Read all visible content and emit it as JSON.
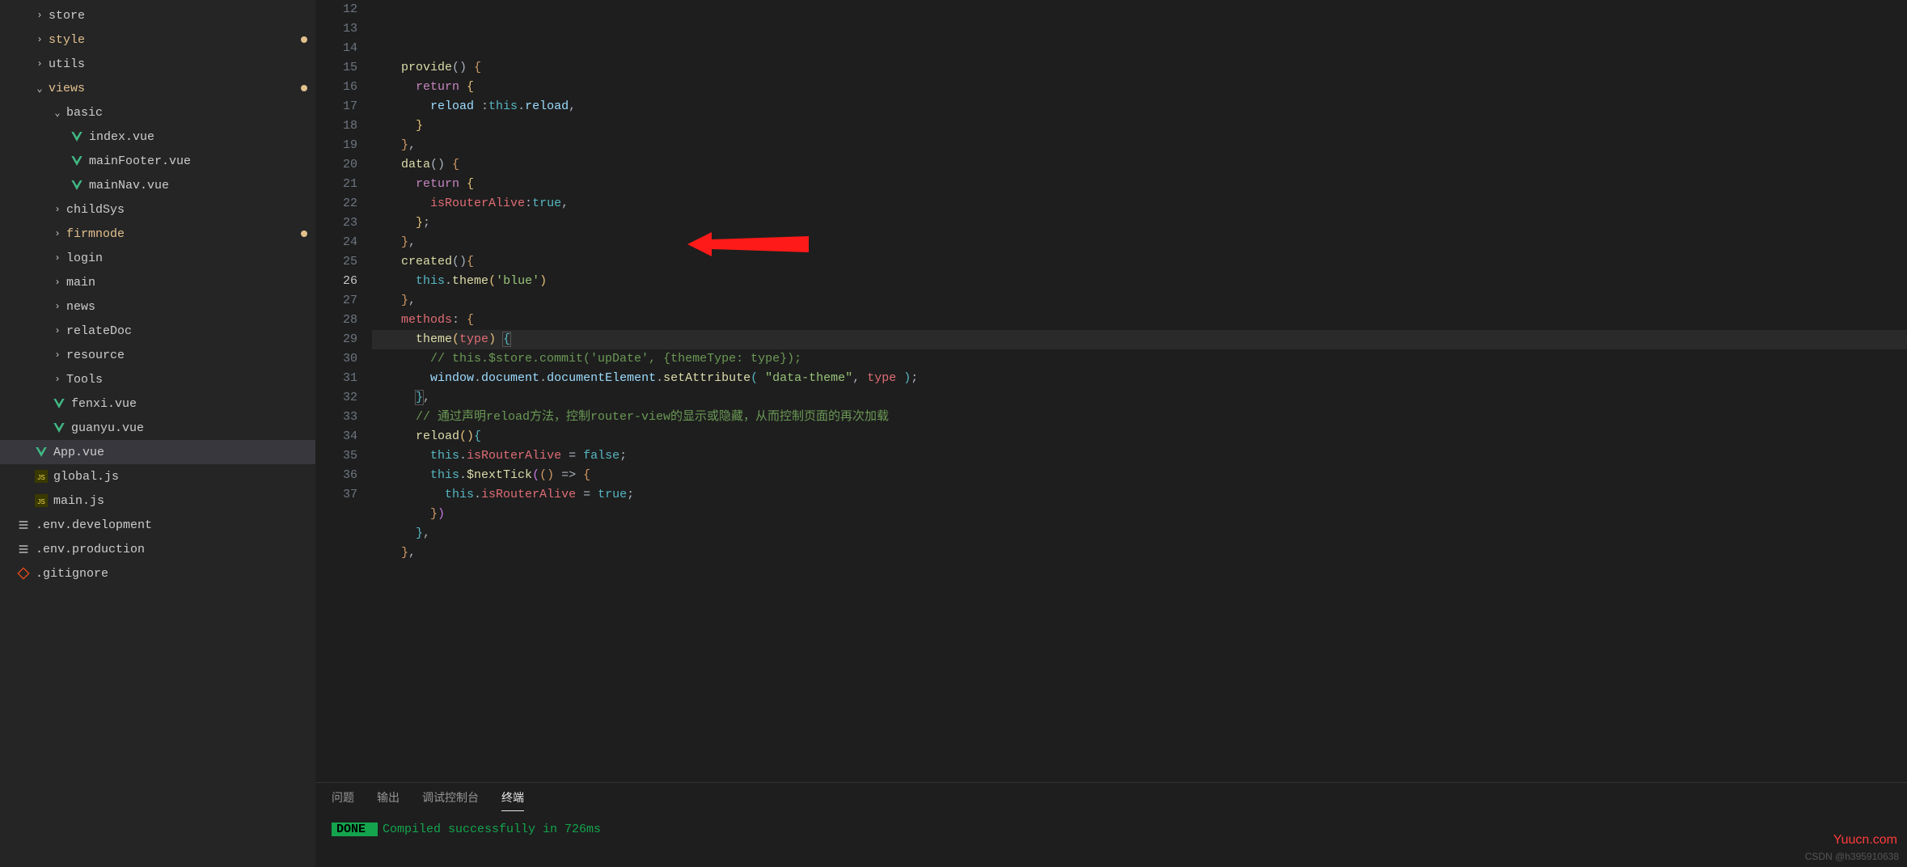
{
  "sidebar": {
    "items": [
      {
        "type": "folder",
        "depth": 1,
        "open": false,
        "label": "store",
        "hl": false,
        "icon": "chev"
      },
      {
        "type": "folder",
        "depth": 1,
        "open": false,
        "label": "style",
        "hl": true,
        "icon": "chev",
        "dot": true
      },
      {
        "type": "folder",
        "depth": 1,
        "open": false,
        "label": "utils",
        "hl": false,
        "icon": "chev"
      },
      {
        "type": "folder",
        "depth": 1,
        "open": true,
        "label": "views",
        "hl": true,
        "icon": "chev",
        "dot": true
      },
      {
        "type": "folder",
        "depth": 2,
        "open": true,
        "label": "basic",
        "hl": false,
        "icon": "chev"
      },
      {
        "type": "file",
        "depth": 3,
        "label": "index.vue",
        "hl": false,
        "icon": "vue"
      },
      {
        "type": "file",
        "depth": 3,
        "label": "mainFooter.vue",
        "hl": false,
        "icon": "vue"
      },
      {
        "type": "file",
        "depth": 3,
        "label": "mainNav.vue",
        "hl": false,
        "icon": "vue"
      },
      {
        "type": "folder",
        "depth": 2,
        "open": false,
        "label": "childSys",
        "hl": false,
        "icon": "chev"
      },
      {
        "type": "folder",
        "depth": 2,
        "open": false,
        "label": "firmnode",
        "hl": true,
        "icon": "chev",
        "dot": true
      },
      {
        "type": "folder",
        "depth": 2,
        "open": false,
        "label": "login",
        "hl": false,
        "icon": "chev"
      },
      {
        "type": "folder",
        "depth": 2,
        "open": false,
        "label": "main",
        "hl": false,
        "icon": "chev"
      },
      {
        "type": "folder",
        "depth": 2,
        "open": false,
        "label": "news",
        "hl": false,
        "icon": "chev"
      },
      {
        "type": "folder",
        "depth": 2,
        "open": false,
        "label": "relateDoc",
        "hl": false,
        "icon": "chev"
      },
      {
        "type": "folder",
        "depth": 2,
        "open": false,
        "label": "resource",
        "hl": false,
        "icon": "chev"
      },
      {
        "type": "folder",
        "depth": 2,
        "open": false,
        "label": "Tools",
        "hl": false,
        "icon": "chev"
      },
      {
        "type": "file",
        "depth": 2,
        "label": "fenxi.vue",
        "hl": false,
        "icon": "vue"
      },
      {
        "type": "file",
        "depth": 2,
        "label": "guanyu.vue",
        "hl": false,
        "icon": "vue"
      },
      {
        "type": "file",
        "depth": 1,
        "label": "App.vue",
        "hl": false,
        "icon": "vue",
        "active": true
      },
      {
        "type": "file",
        "depth": 1,
        "label": "global.js",
        "hl": false,
        "icon": "js"
      },
      {
        "type": "file",
        "depth": 1,
        "label": "main.js",
        "hl": false,
        "icon": "js"
      },
      {
        "type": "file",
        "depth": 0,
        "label": ".env.development",
        "hl": false,
        "icon": "cfg"
      },
      {
        "type": "file",
        "depth": 0,
        "label": ".env.production",
        "hl": false,
        "icon": "cfg"
      },
      {
        "type": "file",
        "depth": 0,
        "label": ".gitignore",
        "hl": false,
        "icon": "git"
      }
    ]
  },
  "editor": {
    "startLine": 12,
    "currentLine": 26,
    "lines": [
      {
        "n": 12,
        "tokens": [
          [
            "    ",
            "w"
          ],
          [
            "provide",
            "fn"
          ],
          [
            "() ",
            "punc"
          ],
          [
            "{",
            "br"
          ]
        ]
      },
      {
        "n": 13,
        "tokens": [
          [
            "      ",
            "w"
          ],
          [
            "return",
            "kw"
          ],
          [
            " ",
            "w"
          ],
          [
            "{",
            "bry"
          ]
        ]
      },
      {
        "n": 14,
        "tokens": [
          [
            "        ",
            "w"
          ],
          [
            "reload ",
            "prop"
          ],
          [
            ":",
            "punc"
          ],
          [
            "this",
            "blue"
          ],
          [
            ".",
            "punc"
          ],
          [
            "reload",
            "prop"
          ],
          [
            ",",
            "punc"
          ]
        ]
      },
      {
        "n": 15,
        "tokens": [
          [
            "      ",
            "w"
          ],
          [
            "}",
            "bry"
          ]
        ]
      },
      {
        "n": 16,
        "tokens": [
          [
            "    ",
            "w"
          ],
          [
            "}",
            "br"
          ],
          [
            ",",
            "punc"
          ]
        ]
      },
      {
        "n": 17,
        "tokens": [
          [
            "    ",
            "w"
          ],
          [
            "data",
            "fn"
          ],
          [
            "() ",
            "punc"
          ],
          [
            "{",
            "br"
          ]
        ]
      },
      {
        "n": 18,
        "tokens": [
          [
            "      ",
            "w"
          ],
          [
            "return",
            "kw"
          ],
          [
            " ",
            "w"
          ],
          [
            "{",
            "bry"
          ]
        ]
      },
      {
        "n": 19,
        "tokens": [
          [
            "        ",
            "w"
          ],
          [
            "isRouterAlive",
            "var"
          ],
          [
            ":",
            "punc"
          ],
          [
            "true",
            "blue"
          ],
          [
            ",",
            "punc"
          ]
        ]
      },
      {
        "n": 20,
        "tokens": [
          [
            "      ",
            "w"
          ],
          [
            "}",
            "bry"
          ],
          [
            ";",
            "punc"
          ]
        ]
      },
      {
        "n": 21,
        "tokens": [
          [
            "    ",
            "w"
          ],
          [
            "}",
            "br"
          ],
          [
            ",",
            "punc"
          ]
        ]
      },
      {
        "n": 22,
        "tokens": [
          [
            "    ",
            "w"
          ],
          [
            "created",
            "fn"
          ],
          [
            "()",
            "punc"
          ],
          [
            "{",
            "br"
          ]
        ]
      },
      {
        "n": 23,
        "tokens": [
          [
            "      ",
            "w"
          ],
          [
            "this",
            "blue"
          ],
          [
            ".",
            "punc"
          ],
          [
            "theme",
            "fn"
          ],
          [
            "(",
            "bry"
          ],
          [
            "'blue'",
            "str"
          ],
          [
            ")",
            "bry"
          ]
        ]
      },
      {
        "n": 24,
        "tokens": [
          [
            "    ",
            "w"
          ],
          [
            "}",
            "br"
          ],
          [
            ",",
            "punc"
          ]
        ]
      },
      {
        "n": 25,
        "tokens": [
          [
            "    ",
            "w"
          ],
          [
            "methods",
            "var"
          ],
          [
            ": ",
            "punc"
          ],
          [
            "{",
            "br"
          ]
        ]
      },
      {
        "n": 26,
        "hl": true,
        "tokens": [
          [
            "      ",
            "w"
          ],
          [
            "theme",
            "fn"
          ],
          [
            "(",
            "bry"
          ],
          [
            "type",
            "var"
          ],
          [
            ")",
            "bry"
          ],
          [
            " ",
            "w"
          ],
          [
            "{",
            "brb",
            "box"
          ]
        ]
      },
      {
        "n": 27,
        "tokens": [
          [
            "        ",
            "w"
          ],
          [
            "// this.$store.commit('upDate', {themeType: type});",
            "cmt"
          ]
        ]
      },
      {
        "n": 28,
        "tokens": [
          [
            "        ",
            "w"
          ],
          [
            "window",
            "prop"
          ],
          [
            ".",
            "punc"
          ],
          [
            "document",
            "prop"
          ],
          [
            ".",
            "punc"
          ],
          [
            "documentElement",
            "prop"
          ],
          [
            ".",
            "punc"
          ],
          [
            "setAttribute",
            "fn"
          ],
          [
            "( ",
            "brb"
          ],
          [
            "\"data-theme\"",
            "str"
          ],
          [
            ", ",
            "punc"
          ],
          [
            "type",
            "var"
          ],
          [
            " )",
            "brb"
          ],
          [
            ";",
            "punc"
          ]
        ]
      },
      {
        "n": 29,
        "tokens": [
          [
            "      ",
            "w"
          ],
          [
            "}",
            "brb",
            "box"
          ],
          [
            ",",
            "punc"
          ]
        ]
      },
      {
        "n": 30,
        "tokens": [
          [
            "      ",
            "w"
          ],
          [
            "// 通过声明reload方法，控制router-view的显示或隐藏，从而控制页面的再次加载",
            "cmt"
          ]
        ]
      },
      {
        "n": 31,
        "tokens": [
          [
            "      ",
            "w"
          ],
          [
            "reload",
            "fn"
          ],
          [
            "()",
            "bry"
          ],
          [
            "{",
            "brb"
          ]
        ]
      },
      {
        "n": 32,
        "tokens": [
          [
            "        ",
            "w"
          ],
          [
            "this",
            "blue"
          ],
          [
            ".",
            "punc"
          ],
          [
            "isRouterAlive",
            "var"
          ],
          [
            " = ",
            "punc"
          ],
          [
            "false",
            "blue"
          ],
          [
            ";",
            "punc"
          ]
        ]
      },
      {
        "n": 33,
        "tokens": [
          [
            "        ",
            "w"
          ],
          [
            "this",
            "blue"
          ],
          [
            ".",
            "punc"
          ],
          [
            "$nextTick",
            "fn"
          ],
          [
            "(",
            "brp"
          ],
          [
            "()",
            "br"
          ],
          [
            " => ",
            "punc"
          ],
          [
            "{",
            "br"
          ]
        ]
      },
      {
        "n": 34,
        "tokens": [
          [
            "          ",
            "w"
          ],
          [
            "this",
            "blue"
          ],
          [
            ".",
            "punc"
          ],
          [
            "isRouterAlive",
            "var"
          ],
          [
            " = ",
            "punc"
          ],
          [
            "true",
            "blue"
          ],
          [
            ";",
            "punc"
          ]
        ]
      },
      {
        "n": 35,
        "tokens": [
          [
            "        ",
            "w"
          ],
          [
            "}",
            "br"
          ],
          [
            ")",
            "brp"
          ]
        ]
      },
      {
        "n": 36,
        "tokens": [
          [
            "      ",
            "w"
          ],
          [
            "}",
            "brb"
          ],
          [
            ",",
            "punc"
          ]
        ]
      },
      {
        "n": 37,
        "tokens": [
          [
            "    ",
            "w"
          ],
          [
            "}",
            "br"
          ],
          [
            ",",
            "punc"
          ]
        ]
      }
    ]
  },
  "panel": {
    "tabs": [
      {
        "label": "问题",
        "active": false
      },
      {
        "label": "输出",
        "active": false
      },
      {
        "label": "调试控制台",
        "active": false
      },
      {
        "label": "终端",
        "active": true
      }
    ],
    "doneBadge": " DONE ",
    "message": " Compiled successfully in 726ms"
  },
  "watermarks": {
    "w1": "Yuucn.com",
    "w2": "CSDN @h395910638"
  }
}
